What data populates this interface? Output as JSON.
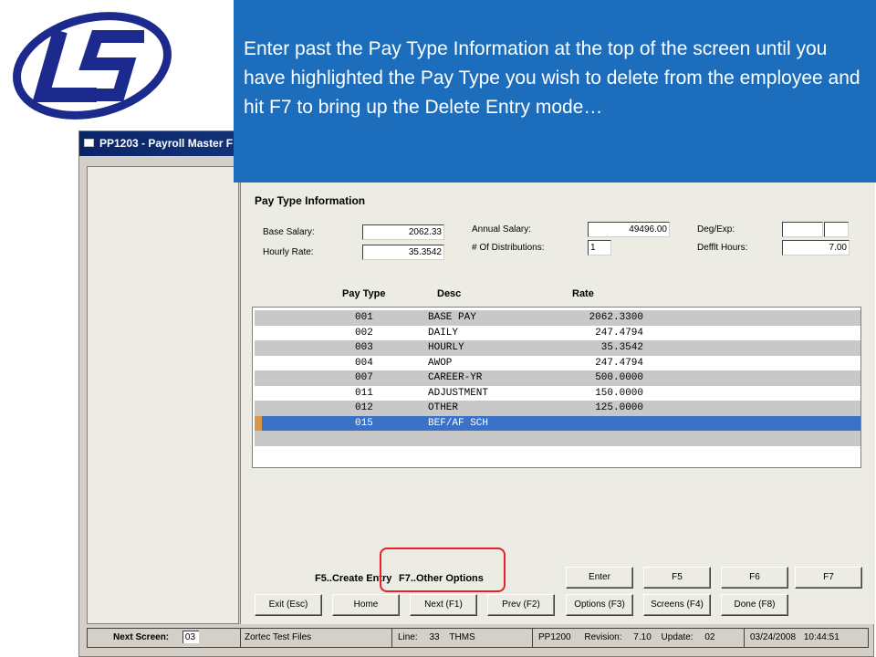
{
  "callout": {
    "text": "Enter past the Pay Type Information at the top of the screen until you have highlighted the Pay Type you wish to delete from the employee and hit F7 to bring up the Delete Entry mode…"
  },
  "window": {
    "title": "PP1203 - Payroll Master F"
  },
  "pay_type_info": {
    "section_title": "Pay Type Information",
    "base_salary_label": "Base Salary:",
    "base_salary_value": "2062.33",
    "hourly_rate_label": "Hourly Rate:",
    "hourly_rate_value": "35.3542",
    "annual_salary_label": "Annual Salary:",
    "annual_salary_value": "49496.00",
    "num_distributions_label": "# Of Distributions:",
    "num_distributions_value": "1",
    "deg_exp_label": "Deg/Exp:",
    "deg_exp_value1": "",
    "deg_exp_value2": "",
    "deflt_hours_label": "Defflt Hours:",
    "deflt_hours_value": "7.00"
  },
  "table": {
    "headers": [
      "Pay Type",
      "Desc",
      "Rate"
    ],
    "rows": [
      {
        "pay_type": "001",
        "desc": "BASE PAY",
        "rate": "2062.3300"
      },
      {
        "pay_type": "002",
        "desc": "DAILY",
        "rate": "247.4794"
      },
      {
        "pay_type": "003",
        "desc": "HOURLY",
        "rate": "35.3542"
      },
      {
        "pay_type": "004",
        "desc": "AWOP",
        "rate": "247.4794"
      },
      {
        "pay_type": "007",
        "desc": "CAREER-YR",
        "rate": "500.0000"
      },
      {
        "pay_type": "011",
        "desc": "ADJUSTMENT",
        "rate": "150.0000"
      },
      {
        "pay_type": "012",
        "desc": "OTHER",
        "rate": "125.0000"
      },
      {
        "pay_type": "015",
        "desc": "BEF/AF SCH",
        "rate": ""
      }
    ],
    "selected_index": 7
  },
  "hints": {
    "f5": "F5..Create Entry",
    "f7": "F7..Other Options"
  },
  "buttons": {
    "enter": "Enter",
    "f5": "F5",
    "f6": "F6",
    "f7": "F7",
    "exit": "Exit (Esc)",
    "home": "Home",
    "next": "Next (F1)",
    "prev": "Prev (F2)",
    "options": "Options (F3)",
    "screens": "Screens (F4)",
    "done": "Done (F8)"
  },
  "statusbar": {
    "next_screen_label": "Next Screen:",
    "next_screen_value": "03",
    "files": "Zortec Test Files",
    "line_label": "Line:",
    "line_value": "33",
    "user": "THMS",
    "program": "PP1200",
    "revision_label": "Revision:",
    "revision_value": "7.10",
    "update_label": "Update:",
    "update_value": "02",
    "date": "03/24/2008",
    "time": "10:44:51"
  },
  "colors": {
    "callout_bg": "#1c6ebd",
    "selected_row": "#3a72c8",
    "highlight_box": "#e8202a",
    "logo_blue": "#1b2a8c"
  }
}
